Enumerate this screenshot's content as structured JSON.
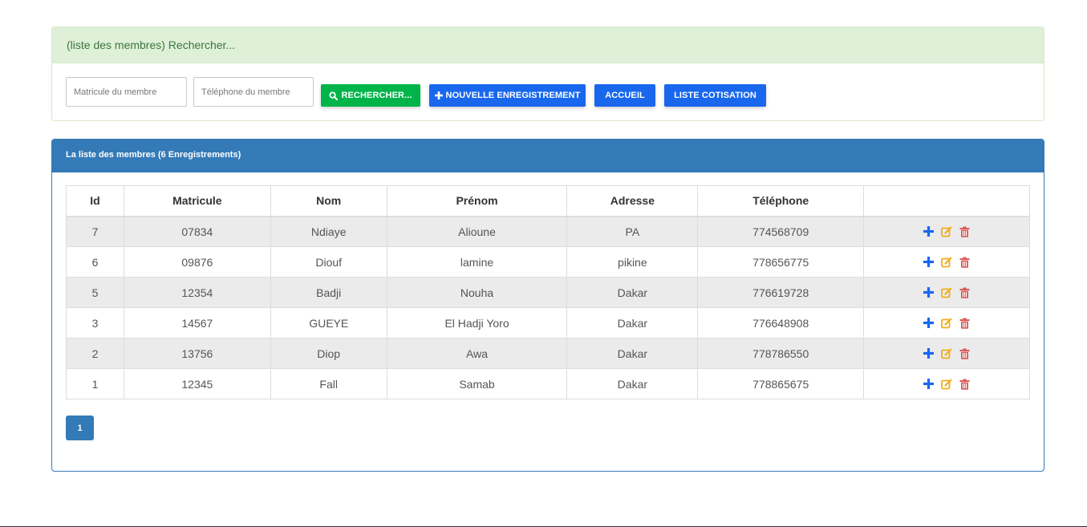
{
  "search": {
    "heading": "(liste des membres) Rechercher...",
    "matricule_placeholder": "Matricule du membre",
    "telephone_placeholder": "Téléphone du membre",
    "search_button": "RECHERCHER...",
    "new_button": "NOUVELLE ENREGISTREMENT",
    "home_button": "ACCUEIL",
    "contributions_button": "LISTE COTISATION"
  },
  "list": {
    "heading": "La liste des membres (6  Enregistrements)",
    "columns": [
      "Id",
      "Matricule",
      "Nom",
      "Prénom",
      "Adresse",
      "Téléphone",
      ""
    ],
    "rows": [
      [
        "7",
        "07834",
        "Ndiaye",
        "Alioune",
        "PA",
        "774568709"
      ],
      [
        "6",
        "09876",
        "Diouf",
        "lamine",
        "pikine",
        "778656775"
      ],
      [
        "5",
        "12354",
        "Badji",
        "Nouha",
        "Dakar",
        "776619728"
      ],
      [
        "3",
        "14567",
        "GUEYE",
        "El Hadji Yoro",
        "Dakar",
        "776648908"
      ],
      [
        "2",
        "13756",
        "Diop",
        "Awa",
        "Dakar",
        "778786550"
      ],
      [
        "1",
        "12345",
        "Fall",
        "Samab",
        "Dakar",
        "778865675"
      ]
    ],
    "page": "1"
  },
  "icons": {
    "search": "search-icon",
    "add": "plus-icon",
    "edit": "edit-icon",
    "delete": "trash-icon"
  },
  "colors": {
    "success_panel": "#dff0d8",
    "primary_panel": "#337ab7",
    "green_button": "#00b44a",
    "blue_button": "#1967ed",
    "add_icon": "#1967ed",
    "edit_icon": "#f0ad1e",
    "delete_icon": "#d9534f"
  }
}
